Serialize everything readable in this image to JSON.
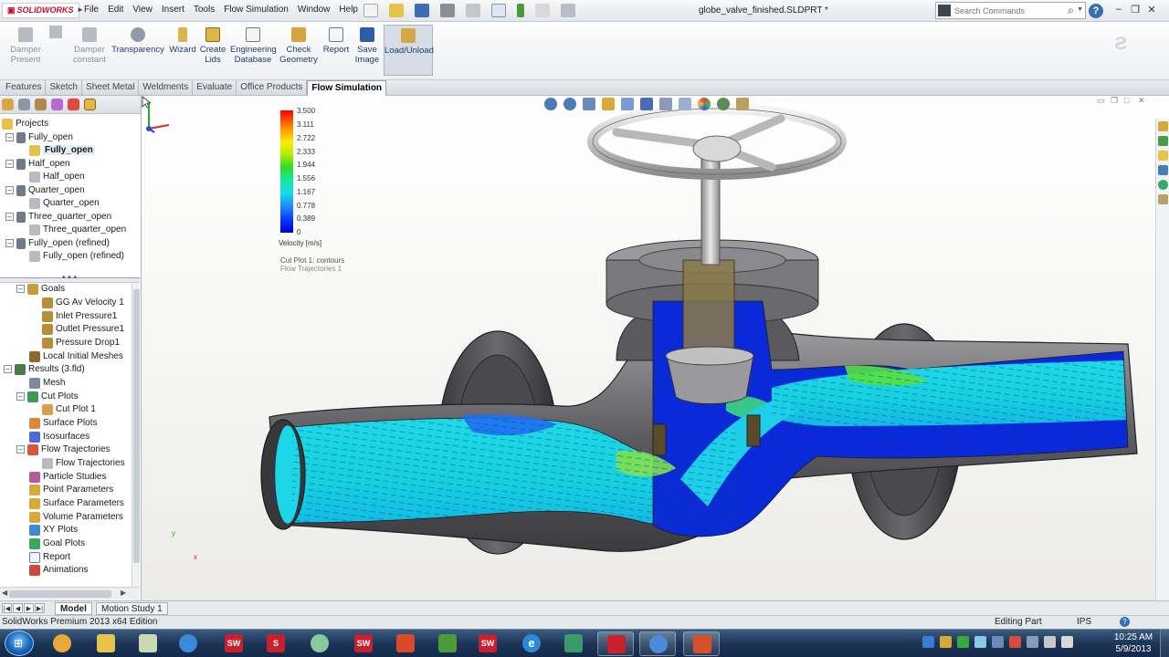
{
  "app": {
    "logo_text": "SOLIDWORKS",
    "menu": [
      "File",
      "Edit",
      "View",
      "Insert",
      "Tools",
      "Flow Simulation",
      "Window",
      "Help"
    ],
    "document_title": "globe_valve_finished.SLDPRT *",
    "search_placeholder": "Search Commands",
    "help": "?"
  },
  "toolbar": {
    "damper_present": "Damper\nPresent",
    "damper_constant": "Damper\nconstant",
    "transparency": "Transparency",
    "wizard": "Wizard",
    "create_lids": "Create\nLids",
    "engineering_database": "Engineering\nDatabase",
    "check_geometry": "Check\nGeometry",
    "report": "Report",
    "save_image": "Save\nImage",
    "load_unload": "Load/Unload"
  },
  "tabs": [
    {
      "label": "Features",
      "active": false
    },
    {
      "label": "Sketch",
      "active": false
    },
    {
      "label": "Sheet Metal",
      "active": false
    },
    {
      "label": "Weldments",
      "active": false
    },
    {
      "label": "Evaluate",
      "active": false
    },
    {
      "label": "Office Products",
      "active": false
    },
    {
      "label": "Flow Simulation",
      "active": true
    }
  ],
  "projects": {
    "root": "Projects",
    "items": [
      {
        "label": "Fully_open",
        "level": 1
      },
      {
        "label": "Fully_open",
        "level": 2,
        "bold": true
      },
      {
        "label": "Half_open",
        "level": 1
      },
      {
        "label": "Half_open",
        "level": 2
      },
      {
        "label": "Quarter_open",
        "level": 1
      },
      {
        "label": "Quarter_open",
        "level": 2
      },
      {
        "label": "Three_quarter_open",
        "level": 1
      },
      {
        "label": "Three_quarter_open",
        "level": 2
      },
      {
        "label": "Fully_open (refined)",
        "level": 1
      },
      {
        "label": "Fully_open (refined)",
        "level": 2
      }
    ]
  },
  "analysis_tree": {
    "items": [
      {
        "label": "Goals",
        "level": 1
      },
      {
        "label": "GG Av Velocity 1",
        "level": 2
      },
      {
        "label": "Inlet Pressure1",
        "level": 2
      },
      {
        "label": "Outlet Pressure1",
        "level": 2
      },
      {
        "label": "Pressure Drop1",
        "level": 2
      },
      {
        "label": "Local Initial Meshes",
        "level": 1
      },
      {
        "label": "Results (3.fld)",
        "level": 0
      },
      {
        "label": "Mesh",
        "level": 1
      },
      {
        "label": "Cut Plots",
        "level": 1
      },
      {
        "label": "Cut Plot 1",
        "level": 2
      },
      {
        "label": "Surface Plots",
        "level": 1
      },
      {
        "label": "Isosurfaces",
        "level": 1
      },
      {
        "label": "Flow Trajectories",
        "level": 1
      },
      {
        "label": "Flow Trajectories",
        "level": 2
      },
      {
        "label": "Particle Studies",
        "level": 1
      },
      {
        "label": "Point Parameters",
        "level": 1
      },
      {
        "label": "Surface Parameters",
        "level": 1
      },
      {
        "label": "Volume Parameters",
        "level": 1
      },
      {
        "label": "XY Plots",
        "level": 1
      },
      {
        "label": "Goal Plots",
        "level": 1
      },
      {
        "label": "Report",
        "level": 1
      },
      {
        "label": "Animations",
        "level": 1
      }
    ]
  },
  "legend": {
    "ticks": [
      "3.500",
      "3.111",
      "2.722",
      "2.333",
      "1.944",
      "1.556",
      "1.167",
      "0.778",
      "0.389",
      "0"
    ],
    "unit": "Velocity [m/s]",
    "plot_names": [
      "Cut Plot 1: contours",
      "Flow Trajectories 1"
    ],
    "colors": {
      "max": "#ff0000",
      "mid": "#33dd22",
      "min": "#0000d0"
    }
  },
  "triad": {
    "x": "x",
    "y": "y"
  },
  "bottom_tabs": [
    {
      "label": "Model",
      "active": true
    },
    {
      "label": "Motion Study 1",
      "active": false
    }
  ],
  "status": {
    "edition": "SolidWorks Premium 2013 x64 Edition",
    "editing": "Editing Part",
    "units": "IPS",
    "help": "?"
  },
  "taskbar": {
    "time": "10:25 AM",
    "date": "5/9/2013",
    "apps": [
      "SW",
      "S",
      "SW",
      "SW",
      "e"
    ]
  }
}
